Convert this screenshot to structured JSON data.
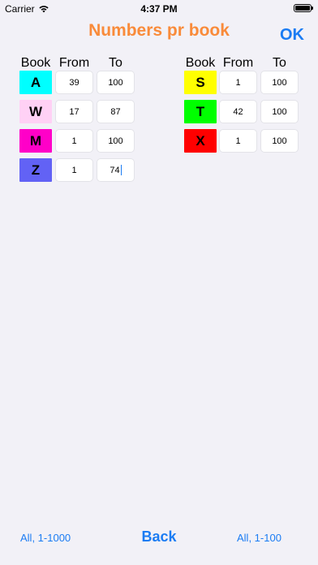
{
  "status_bar": {
    "carrier": "Carrier",
    "time": "4:37 PM",
    "icons": [
      "wifi-icon",
      "battery-icon"
    ]
  },
  "header": {
    "title": "Numbers pr book",
    "ok_label": "OK"
  },
  "columns": {
    "book": "Book",
    "from": "From",
    "to": "To"
  },
  "books_left": [
    {
      "letter": "A",
      "color": "#00ffff",
      "from": "39",
      "to": "100"
    },
    {
      "letter": "W",
      "color": "#ffd1f5",
      "from": "17",
      "to": "87"
    },
    {
      "letter": "M",
      "color": "#ff00c8",
      "from": "1",
      "to": "100"
    },
    {
      "letter": "Z",
      "color": "#6262f5",
      "from": "1",
      "to": "74"
    }
  ],
  "books_right": [
    {
      "letter": "S",
      "color": "#ffff00",
      "from": "1",
      "to": "100"
    },
    {
      "letter": "T",
      "color": "#00ff00",
      "from": "42",
      "to": "100"
    },
    {
      "letter": "X",
      "color": "#ff0000",
      "from": "1",
      "to": "100"
    }
  ],
  "footer": {
    "left_link": "All, 1-1000",
    "back_label": "Back",
    "right_link": "All, 1-100"
  },
  "colors": {
    "accent": "#1b7cf3",
    "title": "#f98b3a",
    "background": "#f2f1f7"
  }
}
